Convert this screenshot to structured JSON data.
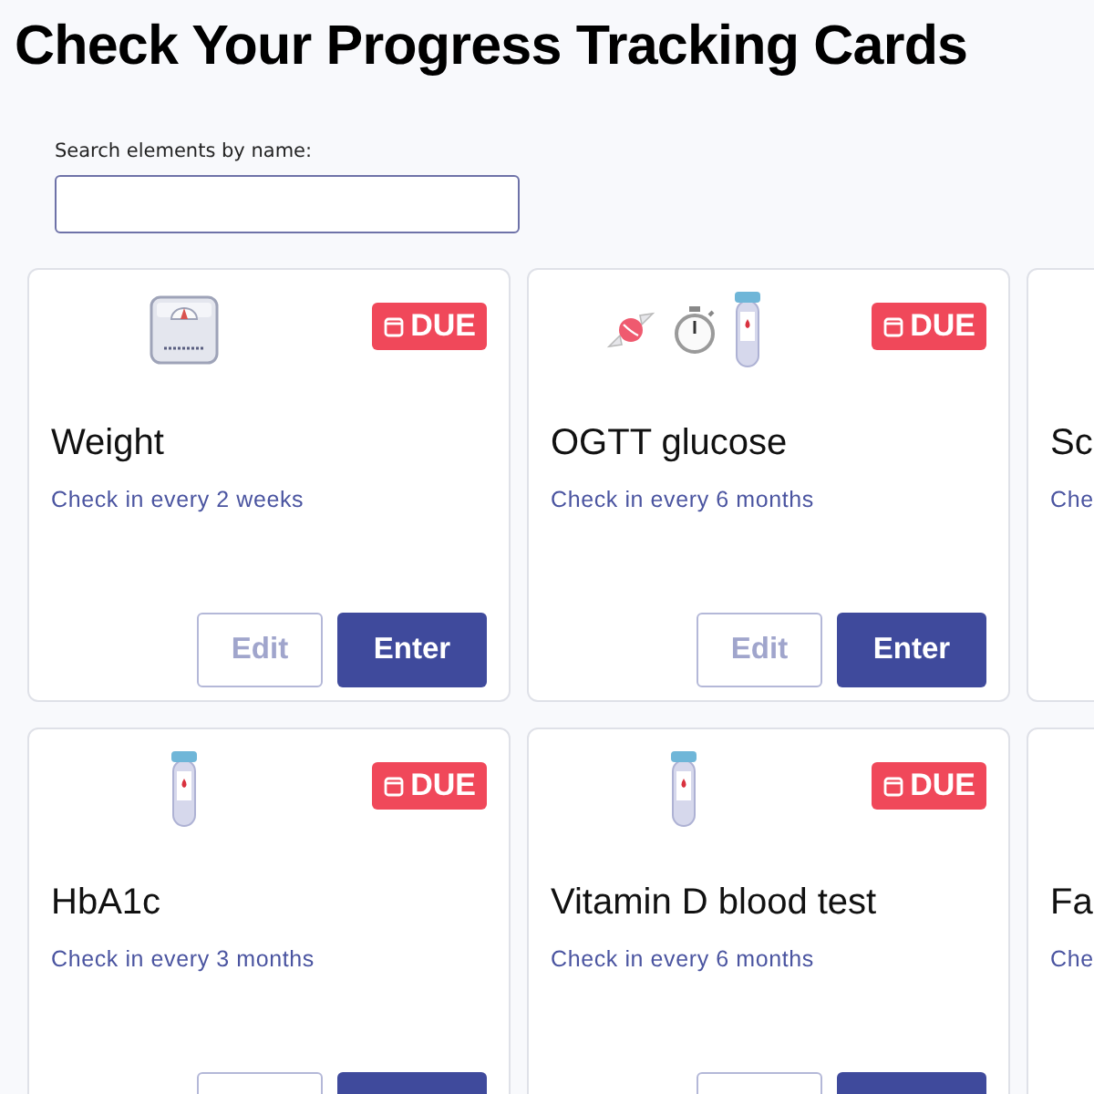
{
  "page_title": "Check Your Progress Tracking Cards",
  "search": {
    "label": "Search elements by name:"
  },
  "cards": [
    {
      "icons": [
        {
          "kind": "scale"
        }
      ],
      "badge": {
        "label": "DUE"
      },
      "title": "Weight",
      "subtitle": "Check in every 2 weeks",
      "actions": [
        {
          "kind": "edit",
          "label": "Edit",
          "disabled": true
        },
        {
          "kind": "enter",
          "label": "Enter",
          "disabled": false
        }
      ]
    },
    {
      "icons": [
        {
          "kind": "candy"
        },
        {
          "kind": "stopwatch"
        },
        {
          "kind": "tube"
        }
      ],
      "badge": {
        "label": "DUE"
      },
      "title": "OGTT glucose",
      "subtitle": "Check in every 6 months",
      "actions": [
        {
          "kind": "edit",
          "label": "Edit",
          "disabled": true
        },
        {
          "kind": "enter",
          "label": "Enter",
          "disabled": false
        }
      ]
    },
    {
      "title": "Sc",
      "subtitle": "Che"
    },
    {
      "icons": [
        {
          "kind": "tube"
        }
      ],
      "badge": {
        "label": "DUE"
      },
      "title": "HbA1c",
      "subtitle": "Check in every 3 months",
      "actions": [
        {
          "kind": "edit",
          "disabled": true
        },
        {
          "kind": "enter",
          "disabled": false
        }
      ]
    },
    {
      "icons": [
        {
          "kind": "tube"
        }
      ],
      "badge": {
        "label": "DUE"
      },
      "title": "Vitamin D blood test",
      "subtitle": "Check in every 6 months",
      "actions": [
        {
          "kind": "edit",
          "disabled": true
        },
        {
          "kind": "enter",
          "disabled": false
        }
      ]
    },
    {
      "title": "Fa",
      "subtitle": "Che"
    }
  ]
}
